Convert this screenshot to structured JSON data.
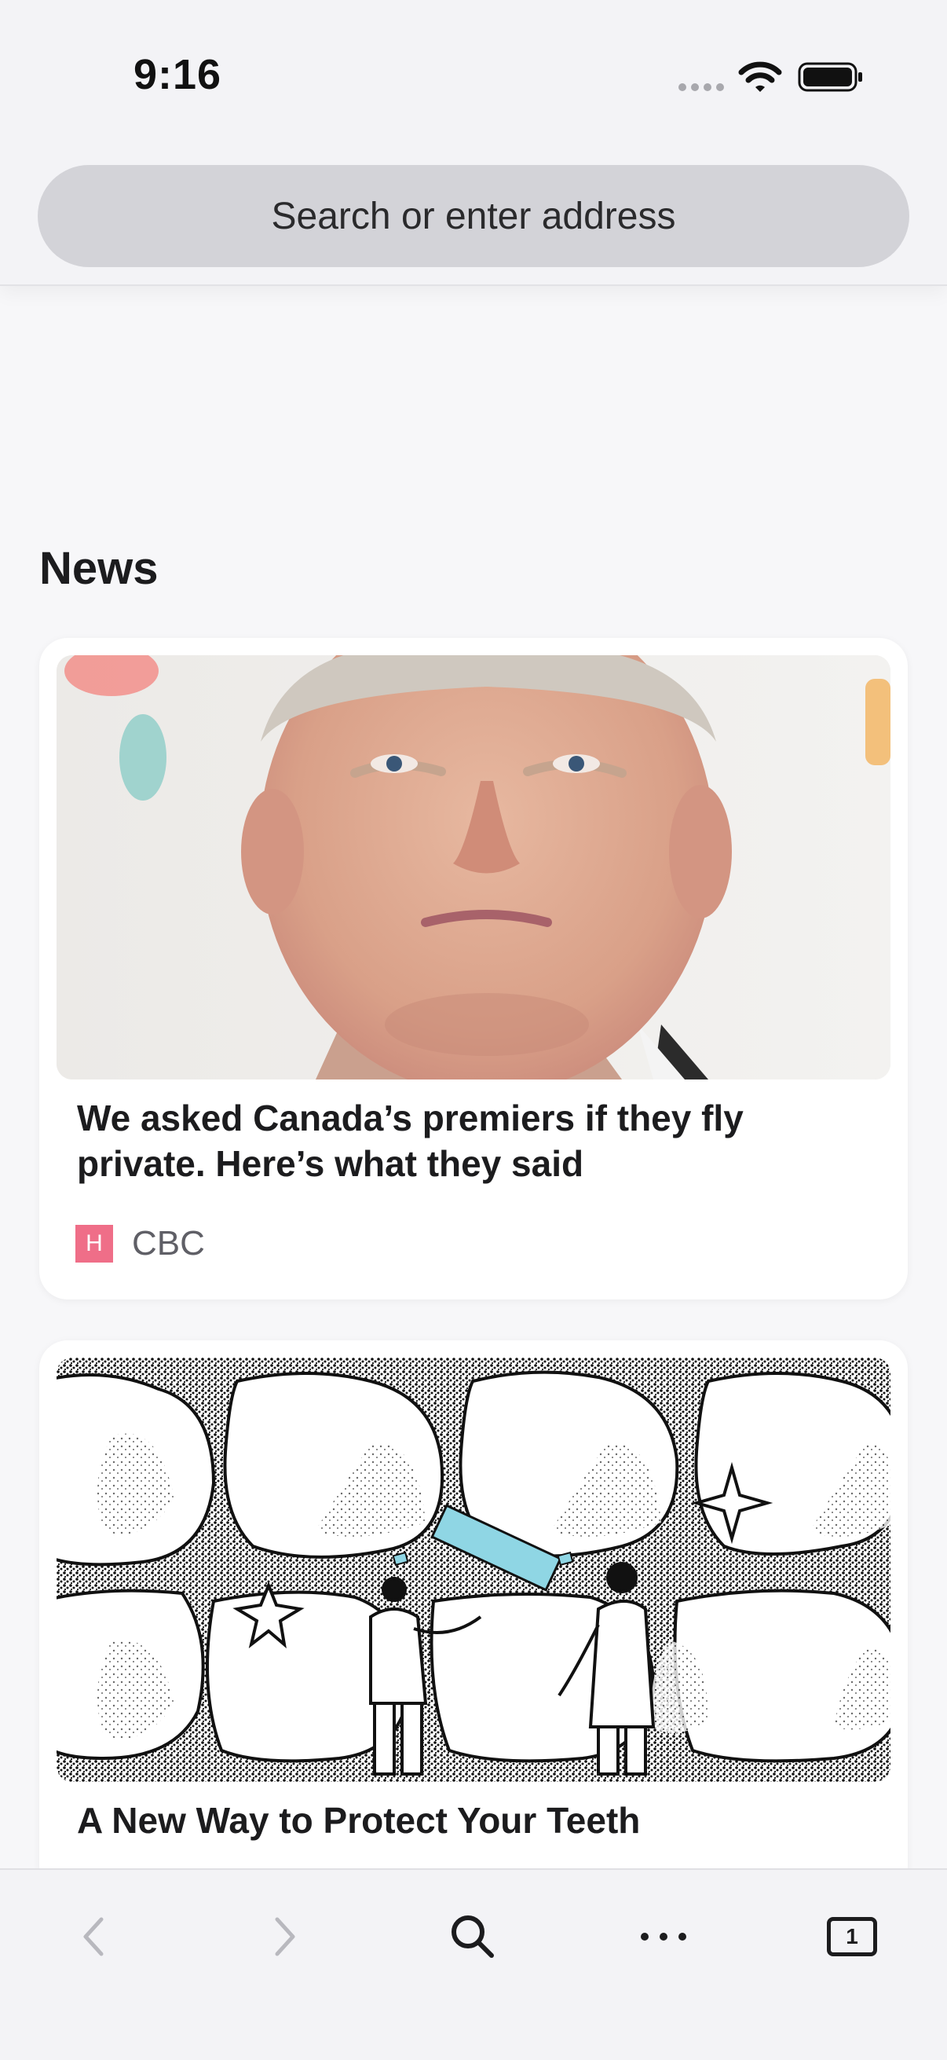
{
  "status_bar": {
    "time": "9:16"
  },
  "address_bar": {
    "placeholder": "Search or enter address"
  },
  "news": {
    "section_title": "News",
    "articles": [
      {
        "headline": "We asked Canada’s premiers if they fly private. Here’s what they said",
        "source_badge": "H",
        "source": "CBC",
        "image": "portrait-photo"
      },
      {
        "headline": "A New Way to Protect Your Teeth",
        "image": "teeth-illustration"
      }
    ]
  },
  "toolbar": {
    "back_icon": "chevron-left-icon",
    "forward_icon": "chevron-right-icon",
    "search_icon": "search-icon",
    "menu_icon": "more-dots-icon",
    "tab_count": "1"
  },
  "colors": {
    "background": "#f7f7f9",
    "address_bar": "#d3d3d8",
    "source_badge": "#ef6e88",
    "toolbar_disabled": "#b8b8be"
  }
}
